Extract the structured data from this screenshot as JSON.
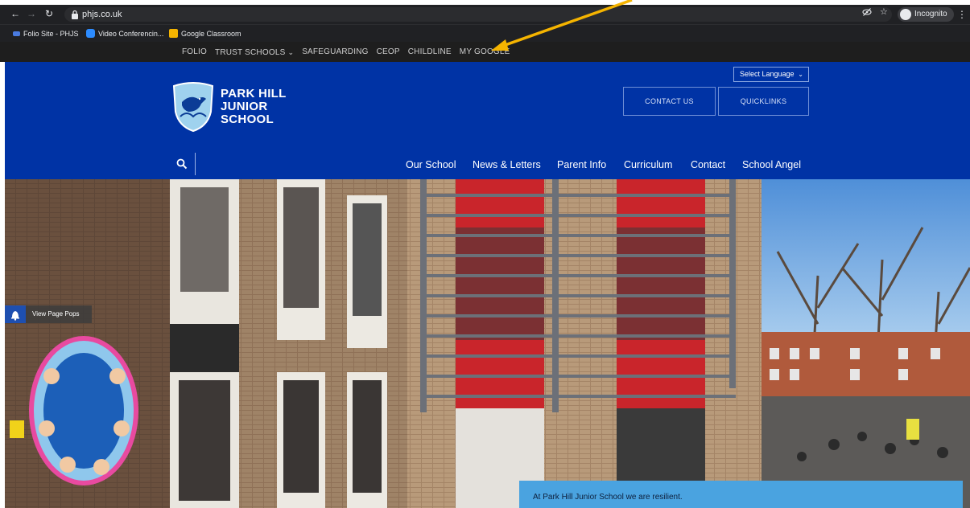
{
  "browser": {
    "url": "phjs.co.uk",
    "profile_label": "Incognito",
    "icons": [
      "back-arrow-icon",
      "forward-arrow-icon",
      "reload-icon",
      "lock-icon",
      "eye-slash-icon",
      "star-icon",
      "incognito-icon",
      "kebab-menu-icon"
    ],
    "bookmarks": [
      {
        "label": "Folio Site - PHJS",
        "color": "#4a7be0"
      },
      {
        "label": "Video Conferencin...",
        "color": "#2d8cff"
      },
      {
        "label": "Google Classroom",
        "color": "#f4b400"
      }
    ]
  },
  "utility_nav": {
    "items": [
      {
        "label": "FOLIO"
      },
      {
        "label": "TRUST SCHOOLS"
      },
      {
        "label": "SAFEGUARDING"
      },
      {
        "label": "CEOP"
      },
      {
        "label": "CHILDLINE"
      },
      {
        "label": "MY GOOGLE"
      }
    ],
    "dropdown_indicator": "⌄"
  },
  "header": {
    "logo_lines": [
      "PARK HILL",
      "JUNIOR",
      "SCHOOL"
    ],
    "brand_color": "#0033a5",
    "language_select": "Select Language",
    "buttons": [
      {
        "label": "CONTACT US"
      },
      {
        "label": "QUICKLINKS"
      }
    ]
  },
  "main_nav": {
    "items": [
      {
        "label": "Our School"
      },
      {
        "label": "News & Letters"
      },
      {
        "label": "Parent Info"
      },
      {
        "label": "Curriculum"
      },
      {
        "label": "Contact"
      },
      {
        "label": "School Angel"
      }
    ]
  },
  "page_pops": {
    "label": "View Page Pops"
  },
  "hero": {
    "motto": "At Park Hill Junior School we are resilient.",
    "motto_color": "#4aa3e0"
  },
  "annotation": {
    "arrow_color": "#f5b400"
  }
}
